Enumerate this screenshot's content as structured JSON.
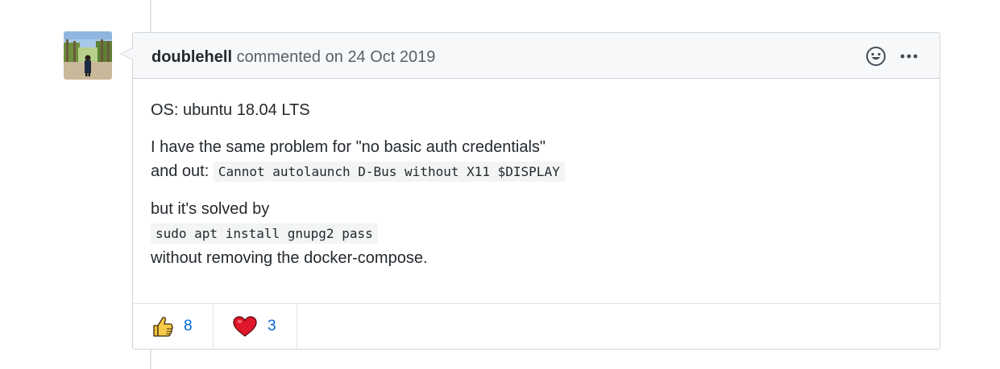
{
  "comment": {
    "author": "doublehell",
    "action": "commented",
    "date_prefix": "on",
    "date": "24 Oct 2019",
    "body": {
      "line1": "OS: ubuntu 18.04 LTS",
      "line2": "I have the same problem for \"no basic auth credentials\"",
      "line3_prefix": "and out:",
      "code1": "Cannot autolaunch D-Bus without X11 $DISPLAY",
      "line4": "but it's solved by",
      "code2": "sudo apt install gnupg2 pass",
      "line5": "without removing the docker-compose."
    },
    "header_icons": [
      "smiley-icon",
      "kebab-menu-icon"
    ]
  },
  "reactions": [
    {
      "icon": "thumbs-up-icon",
      "count": "8"
    },
    {
      "icon": "heart-icon",
      "count": "3"
    }
  ],
  "colors": {
    "link": "#0366d6",
    "border": "#d1d5da",
    "header_bg": "#f6f8fa",
    "text": "#24292e",
    "muted": "#586069"
  }
}
